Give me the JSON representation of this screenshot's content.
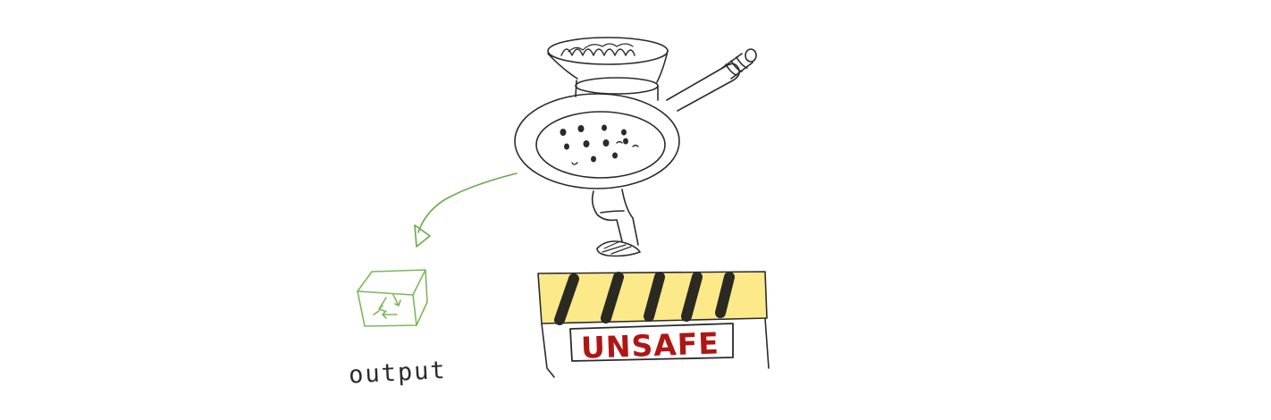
{
  "labels": {
    "output": "output",
    "unsafe": "UNSAFE"
  },
  "icons": {
    "grinder": "meat-grinder-icon",
    "recycle_box": "recycle-box-icon",
    "barrier": "hazard-barrier-icon"
  },
  "colors": {
    "ink": "#2b2b2b",
    "arrow": "#6aa84f",
    "recycle": "#7cb85a",
    "barrier_yellow": "#fce98a",
    "stripe": "#2a2a22",
    "unsafe_text": "#b01515"
  }
}
